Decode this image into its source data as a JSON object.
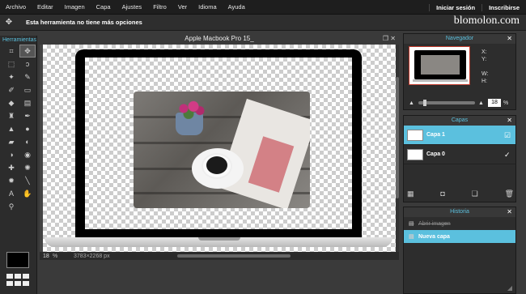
{
  "menu": {
    "items": [
      "Archivo",
      "Editar",
      "Imagen",
      "Capa",
      "Ajustes",
      "Filtro",
      "Ver",
      "Idioma",
      "Ayuda"
    ],
    "login": "Iniciar sesión",
    "signup": "Inscribirse"
  },
  "options": {
    "message": "Esta herramienta no tiene más opciones"
  },
  "brand": "blomolon.com",
  "toolbox": {
    "title": "Herramientas",
    "tools": [
      "crop-icon",
      "move-icon",
      "marquee-icon",
      "lasso-icon",
      "wand-icon",
      "pencil-icon",
      "brush-icon",
      "eraser-icon",
      "bucket-icon",
      "gradient-icon",
      "stamp-icon",
      "colorreplace-icon",
      "drawing-icon",
      "blur-icon",
      "sponge-icon",
      "dodge-icon",
      "burn-icon",
      "redeye-icon",
      "spot-icon",
      "bloat-icon",
      "pinch-icon",
      "eyedropper-icon",
      "text-icon",
      "hand-icon",
      "zoom-icon"
    ]
  },
  "document": {
    "title": "Apple Macbook Pro 15_",
    "zoom": "18",
    "zoom_unit": "%",
    "dimensions": "3783×2268 px"
  },
  "navigator": {
    "title": "Navegador",
    "x_label": "X:",
    "y_label": "Y:",
    "w_label": "W:",
    "h_label": "H:",
    "zoom_value": "18",
    "zoom_unit": "%"
  },
  "layers": {
    "title": "Capas",
    "items": [
      {
        "name": "Capa 1",
        "selected": true
      },
      {
        "name": "Capa 0",
        "selected": false
      }
    ]
  },
  "history": {
    "title": "Historia",
    "items": [
      {
        "label": "Abrir imagen",
        "state": "dim"
      },
      {
        "label": "Nueva capa",
        "state": "selected"
      }
    ]
  },
  "colors": {
    "accent": "#5bc0de",
    "menubar": "#1e1e1e",
    "panel": "#2d2d2d"
  }
}
